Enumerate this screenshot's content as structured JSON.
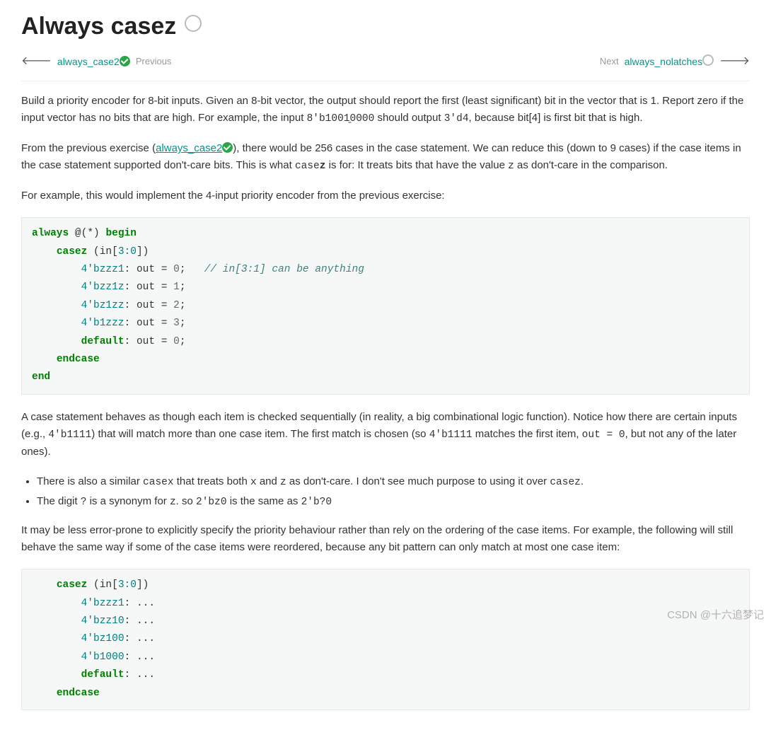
{
  "title": "Always casez",
  "nav": {
    "prev_link": "always_case2",
    "prev_label": "Previous",
    "next_label": "Next",
    "next_link": "always_nolatches"
  },
  "para1": {
    "a": "Build a priority encoder for 8-bit inputs. Given an 8-bit vector, the output should report the first (least significant) bit in the vector that is 1. Report zero if the input vector has no bits that are high. For example, the input ",
    "code1": "8'b1001̱0000",
    "b": " should output ",
    "code2": "3'd4",
    "c": ", because bit[4] is first bit that is high."
  },
  "para2": {
    "a": "From the previous exercise (",
    "link": "always_case2",
    "b": "), there would be 256 cases in the case statement. We can reduce this (down to 9 cases) if the case items in the case statement supported don't-care bits. This is what ",
    "code1": "case",
    "code1b": "z",
    "c": " is for: It treats bits that have the value ",
    "code2": "z",
    "d": " as don't-care in the comparison."
  },
  "para3": "For example, this would implement the 4-input priority encoder from the previous exercise:",
  "code_block_1": {
    "l1_kw1": "always",
    "l1_mid": " @(*) ",
    "l1_kw2": "begin",
    "l2_kw": "casez",
    "l2_args": " (in[",
    "l2_range": "3:0",
    "l2_close": "])",
    "l3_lit": "4'bzzz1",
    "l3_rest": ": out = ",
    "l3_val": "0",
    "l3_semi": ";   ",
    "l3_comment": "// in[3:1] can be anything",
    "l4_lit": "4'bzz1z",
    "l4_rest": ": out = ",
    "l4_val": "1",
    "l4_semi": ";",
    "l5_lit": "4'bz1zz",
    "l5_rest": ": out = ",
    "l5_val": "2",
    "l5_semi": ";",
    "l6_lit": "4'b1zzz",
    "l6_rest": ": out = ",
    "l6_val": "3",
    "l6_semi": ";",
    "l7_kw": "default",
    "l7_rest": ": out = ",
    "l7_val": "0",
    "l7_semi": ";",
    "l8_kw": "endcase",
    "l9_kw": "end"
  },
  "para4": {
    "a": "A case statement behaves as though each item is checked sequentially (in reality, a big combinational logic function). Notice how there are certain inputs (e.g., ",
    "code1": "4'b1111",
    "b": ") that will match more than one case item. The first match is chosen (so ",
    "code2": "4'b1111",
    "c": " matches the first item, ",
    "code3": "out = 0",
    "d": ", but not any of the later ones)."
  },
  "bullets": {
    "b1": {
      "a": "There is also a similar ",
      "code1": "casex",
      "b": " that treats both ",
      "code2": "x",
      "c": " and ",
      "code3": "z",
      "d": " as don't-care. I don't see much purpose to using it over ",
      "code4": "casez",
      "e": "."
    },
    "b2": {
      "a": "The digit ",
      "code1": "?",
      "b": " is a synonym for ",
      "code2": "z",
      "c": ". so ",
      "code3": "2'bz0",
      "d": " is the same as ",
      "code4": "2'b?0"
    }
  },
  "para5": "It may be less error-prone to explicitly specify the priority behaviour rather than rely on the ordering of the case items. For example, the following will still behave the same way if some of the case items were reordered, because any bit pattern can only match at most one case item:",
  "code_block_2": {
    "l1_kw": "casez",
    "l1_args": " (in[",
    "l1_range": "3:0",
    "l1_close": "])",
    "l2_lit": "4'bzzz1",
    "l2_rest": ": ...",
    "l3_lit": "4'bzz10",
    "l3_rest": ": ...",
    "l4_lit": "4'bz100",
    "l4_rest": ": ...",
    "l5_lit": "4'b1000",
    "l5_rest": ": ...",
    "l6_kw": "default",
    "l6_rest": ": ...",
    "l7_kw": "endcase"
  },
  "watermark": "CSDN @十六追梦记"
}
